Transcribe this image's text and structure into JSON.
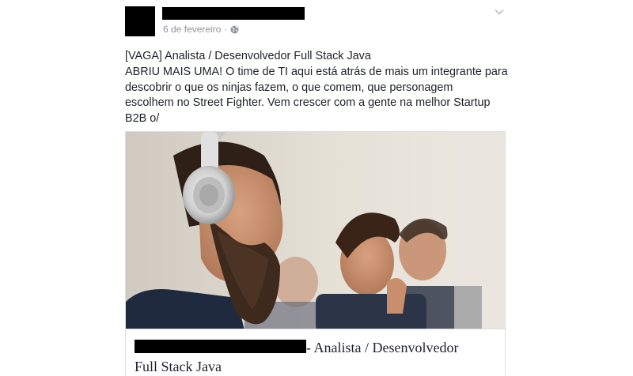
{
  "post": {
    "date": "6 de fevereiro",
    "separator": "·",
    "privacy_icon": "globe-icon",
    "menu_icon": "chevron-down-icon",
    "text": "[VAGA] Analista / Desenvolvedor Full Stack Java\nABRIU MAIS UMA! O time de TI aqui está atrás de mais um integrante para\ndescobrir o que os ninjas fazem, o que comem, que personagem\nescolhem no Street Fighter. Vem crescer com a gente na melhor Startup\nB2B o/"
  },
  "link_preview": {
    "title_line1": "- Analista / Desenvolvedor",
    "title_line2": "Full Stack Java"
  }
}
